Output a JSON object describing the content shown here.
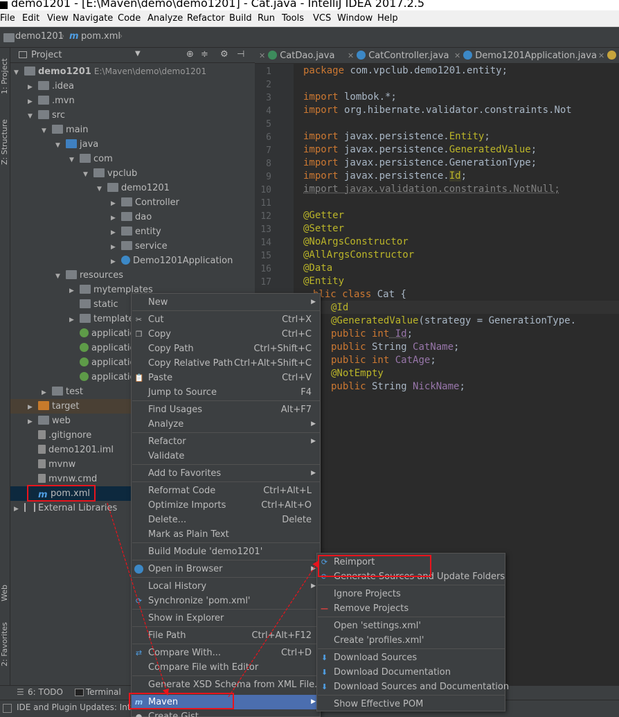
{
  "window": {
    "title": "demo1201 - [E:\\Maven\\demo\\demo1201] - Cat.java - IntelliJ IDEA 2017.2.5"
  },
  "menubar": [
    "File",
    "Edit",
    "View",
    "Navigate",
    "Code",
    "Analyze",
    "Refactor",
    "Build",
    "Run",
    "Tools",
    "VCS",
    "Window",
    "Help"
  ],
  "breadcrumb": {
    "project": "demo1201",
    "file": "pom.xml"
  },
  "left_tabs": {
    "project": "1: Project",
    "structure": "Z: Structure",
    "web": "Web",
    "favorites": "2: Favorites"
  },
  "project_panel": {
    "view_label": "Project",
    "root": "demo1201",
    "root_path": "E:\\Maven\\demo\\demo1201",
    "tree": [
      ".idea",
      ".mvn",
      "src",
      "main",
      "java",
      "com",
      "vpclub",
      "demo1201",
      "Controller",
      "dao",
      "entity",
      "service",
      "Demo1201Application",
      "resources",
      "mytemplates",
      "static",
      "template",
      "applicatio",
      "applicatio",
      "applicatio",
      "applicatio",
      "test",
      "target",
      "web",
      ".gitignore",
      "demo1201.iml",
      "mvnw",
      "mvnw.cmd",
      "pom.xml",
      "External Libraries"
    ]
  },
  "editor": {
    "tabs": [
      "CatDao.java",
      "CatController.java",
      "Demo1201Application.java"
    ],
    "line_numbers": [
      "1",
      "2",
      "3",
      "4",
      "5",
      "6",
      "7",
      "8",
      "9",
      "10",
      "11",
      "12",
      "13",
      "14",
      "15",
      "16",
      "17"
    ],
    "code": {
      "l1_kw": "package",
      "l1_rest": " com.vpclub.demo1201.entity;",
      "l3_kw": "import",
      "l3_rest": " lombok.*;",
      "l4_kw": "import",
      "l4_rest": " org.hibernate.validator.constraints.Not",
      "l6_kw": "import",
      "l6_a": " javax.persistence.",
      "l6_b": "Entity",
      "l6_c": ";",
      "l7_kw": "import",
      "l7_a": " javax.persistence.",
      "l7_b": "GeneratedValue",
      "l7_c": ";",
      "l8_kw": "import",
      "l8_a": " javax.persistence.",
      "l8_b": "GenerationType",
      "l8_c": ";",
      "l9_kw": "import",
      "l9_a": " javax.persistence.",
      "l9_b": "Id",
      "l9_c": ";",
      "l10": "import javax.validation.constraints.NotNull;",
      "l12": "@Getter",
      "l13": "@Setter",
      "l14": "@NoArgsConstructor",
      "l15": "@AllArgsConstructor",
      "l16": "@Data",
      "l17": "@Entity",
      "l18_kw": "blic class",
      "l18_rest": " Cat {",
      "l19": "@Id",
      "l20_an": "@GeneratedValue",
      "l20_rest": "(strategy = GenerationType.",
      "l21_kw": "public int",
      "l21_fd": " Id",
      "l21_c": ";",
      "l22_kw": "public",
      "l22_rest": " String ",
      "l22_fd": "CatName",
      "l22_c": ";",
      "l23_kw": "public int",
      "l23_fd": " CatAge",
      "l23_c": ";",
      "l24": "@NotEmpty",
      "l25_kw": "public",
      "l25_rest": " String ",
      "l25_fd": "NickName",
      "l25_c": ";"
    }
  },
  "context_menu": [
    {
      "label": "New",
      "shortcut": "",
      "submenu": true
    },
    {
      "label": "Cut",
      "shortcut": "Ctrl+X"
    },
    {
      "label": "Copy",
      "shortcut": "Ctrl+C"
    },
    {
      "label": "Copy Path",
      "shortcut": "Ctrl+Shift+C"
    },
    {
      "label": "Copy Relative Path",
      "shortcut": "Ctrl+Alt+Shift+C"
    },
    {
      "label": "Paste",
      "shortcut": "Ctrl+V"
    },
    {
      "label": "Jump to Source",
      "shortcut": "F4"
    },
    {
      "label": "Find Usages",
      "shortcut": "Alt+F7"
    },
    {
      "label": "Analyze",
      "shortcut": "",
      "submenu": true
    },
    {
      "label": "Refactor",
      "shortcut": "",
      "submenu": true
    },
    {
      "label": "Validate",
      "shortcut": ""
    },
    {
      "label": "Add to Favorites",
      "shortcut": "",
      "submenu": true
    },
    {
      "label": "Reformat Code",
      "shortcut": "Ctrl+Alt+L"
    },
    {
      "label": "Optimize Imports",
      "shortcut": "Ctrl+Alt+O"
    },
    {
      "label": "Delete...",
      "shortcut": "Delete"
    },
    {
      "label": "Mark as Plain Text",
      "shortcut": ""
    },
    {
      "label": "Build Module 'demo1201'",
      "shortcut": ""
    },
    {
      "label": "Open in Browser",
      "shortcut": "",
      "submenu": true
    },
    {
      "label": "Local History",
      "shortcut": "",
      "submenu": true
    },
    {
      "label": "Synchronize 'pom.xml'",
      "shortcut": ""
    },
    {
      "label": "Show in Explorer",
      "shortcut": ""
    },
    {
      "label": "File Path",
      "shortcut": "Ctrl+Alt+F12"
    },
    {
      "label": "Compare With...",
      "shortcut": "Ctrl+D"
    },
    {
      "label": "Compare File with Editor",
      "shortcut": ""
    },
    {
      "label": "Generate XSD Schema from XML File...",
      "shortcut": ""
    },
    {
      "label": "Maven",
      "shortcut": "",
      "submenu": true
    },
    {
      "label": "Create Gist...",
      "shortcut": ""
    }
  ],
  "maven_submenu": [
    "Reimport",
    "Generate Sources and Update Folders",
    "Ignore Projects",
    "Remove Projects",
    "Open 'settings.xml'",
    "Create 'profiles.xml'",
    "Download Sources",
    "Download Documentation",
    "Download Sources and Documentation",
    "Show Effective POM"
  ],
  "bottom_tools": {
    "todo": "6: TODO",
    "terminal": "Terminal"
  },
  "status": {
    "text": "IDE and Plugin Updates: Int"
  },
  "colors": {
    "highlight_red": "#e8141c",
    "selection_blue": "#4b6eaf",
    "keyword": "#cc7832",
    "annotation": "#bbb529",
    "field": "#9876aa"
  }
}
